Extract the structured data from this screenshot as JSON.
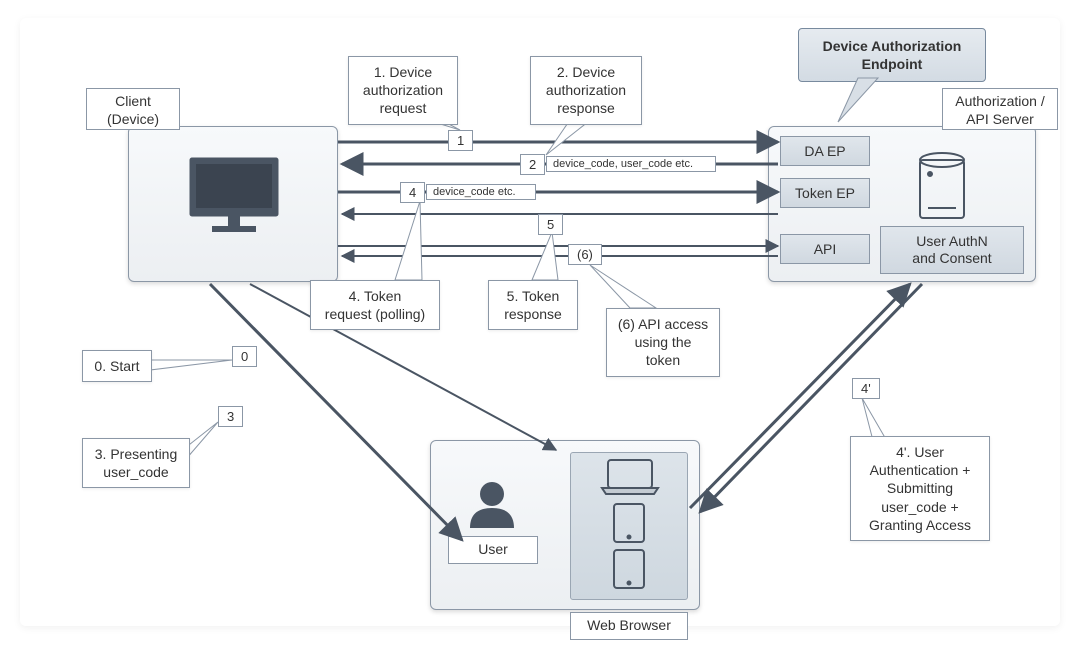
{
  "labels": {
    "client": "Client\n(Device)",
    "server": "Authorization /\nAPI Server",
    "user": "User",
    "browser": "Web Browser",
    "da_ep": "DA EP",
    "token_ep": "Token EP",
    "api": "API",
    "authn": "User AuthN\nand Consent"
  },
  "banner": "Device Authorization\nEndpoint",
  "steps": {
    "s0": "0. Start",
    "s1": "1. Device\nauthorization\nrequest",
    "s2": "2. Device\nauthorization\nresponse",
    "s3": "3. Presenting\nuser_code",
    "s4": "4. Token\nrequest (polling)",
    "s5": "5. Token\nresponse",
    "s6": "(6) API access\nusing the\ntoken",
    "s4p": "4'. User\nAuthentication +\nSubmitting\nuser_code +\nGranting Access"
  },
  "nums": {
    "n0": "0",
    "n1": "1",
    "n2": "2",
    "n3": "3",
    "n4": "4",
    "n4p": "4'",
    "n5": "5",
    "n6": "(6)"
  },
  "msgs": {
    "m2": "device_code, user_code etc.",
    "m4": "device_code etc."
  }
}
